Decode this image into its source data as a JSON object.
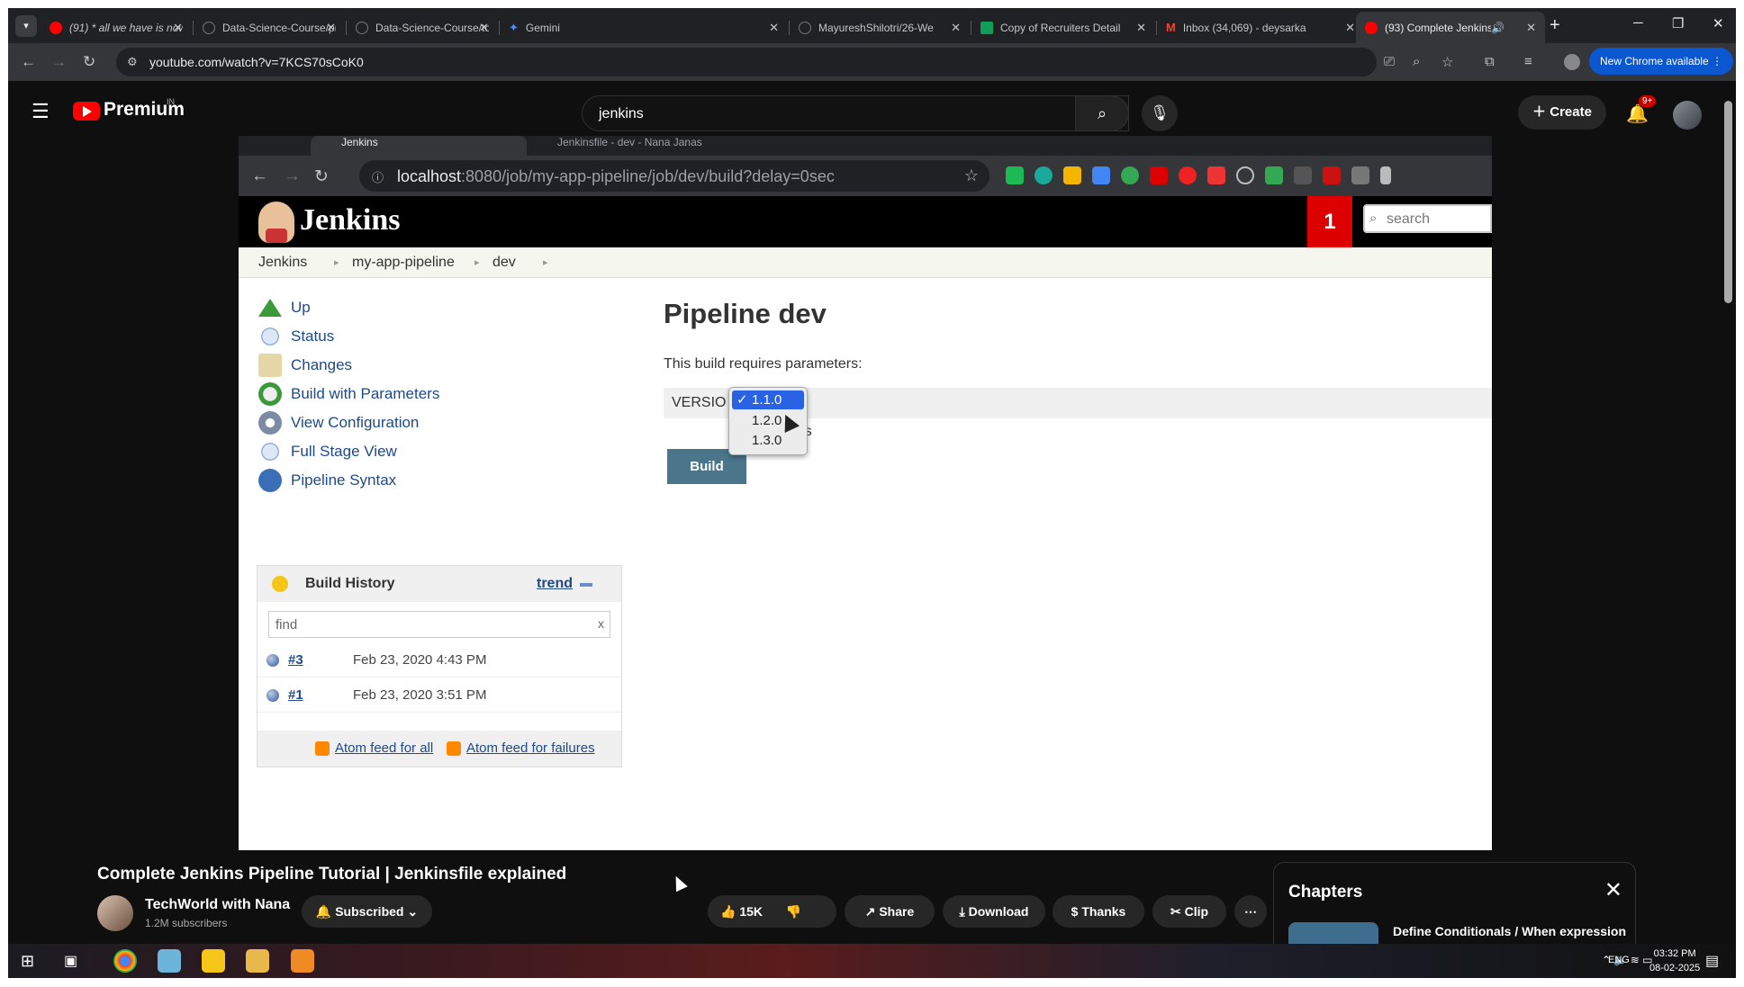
{
  "browser": {
    "tabs": [
      {
        "title": "(91) * all we have is now.",
        "color": "#ff0000"
      },
      {
        "title": "Data-Science-Course/pre",
        "color": "#5f6368"
      },
      {
        "title": "Data-Science-Course/top",
        "color": "#5f6368"
      },
      {
        "title": "Gemini",
        "color": "#4e8cf5"
      },
      {
        "title": "MayureshShilotri/26-We",
        "color": "#5f6368"
      },
      {
        "title": "Copy of Recruiters Detail",
        "color": "#0f9d58"
      },
      {
        "title": "Inbox (34,069) - deysarka",
        "color": "#ea4335"
      },
      {
        "title": "(93) Complete Jenkins",
        "color": "#ff0000"
      }
    ],
    "url": "youtube.com/watch?v=7KCS70sCoK0",
    "new_chrome": "New Chrome available"
  },
  "youtube": {
    "brand": "Premium",
    "country": "IN",
    "search_query": "jenkins",
    "create_label": "Create",
    "notifications": "9+",
    "video_title": "Complete Jenkins Pipeline Tutorial | Jenkinsfile explained",
    "channel_name": "TechWorld with Nana",
    "subscribers": "1.2M subscribers",
    "subscribed_label": "Subscribed",
    "likes": "15K",
    "share_label": "Share",
    "download_label": "Download",
    "thanks_label": "Thanks",
    "clip_label": "Clip",
    "chapters_title": "Chapters",
    "chapter_item": "Define Conditionals / When expression"
  },
  "video_frame": {
    "tab_active": "Jenkins",
    "tab_other": "Jenkinsfile - dev - Nana Janas",
    "url_host": "localhost",
    "url_rest": ":8080/job/my-app-pipeline/job/dev/build?delay=0sec",
    "jenkins_logo": "Jenkins",
    "alert_count": "1",
    "search_placeholder": "search",
    "breadcrumbs": [
      "Jenkins",
      "my-app-pipeline",
      "dev"
    ],
    "sidebar": [
      "Up",
      "Status",
      "Changes",
      "Build with Parameters",
      "View Configuration",
      "Full Stage View",
      "Pipeline Syntax"
    ],
    "build_history": {
      "title": "Build History",
      "trend": "trend",
      "find_placeholder": "find",
      "clear": "x",
      "builds": [
        {
          "num": "#3",
          "date": "Feb 23, 2020 4:43 PM"
        },
        {
          "num": "#1",
          "date": "Feb 23, 2020 3:51 PM"
        }
      ],
      "feed_all": "Atom feed for all",
      "feed_failures": "Atom feed for failures"
    },
    "pipeline_title": "Pipeline dev",
    "requires": "This build requires parameters:",
    "param_label": "VERSIO",
    "checkbox_label": "teTests",
    "dropdown_options": [
      "1.1.0",
      "1.2.0",
      "1.3.0"
    ],
    "selected_option": "1.1.0",
    "check_mark": "✓",
    "build_button": "Build"
  },
  "taskbar": {
    "lang": "ENG",
    "time": "03:32 PM",
    "date": "08-02-2025"
  }
}
